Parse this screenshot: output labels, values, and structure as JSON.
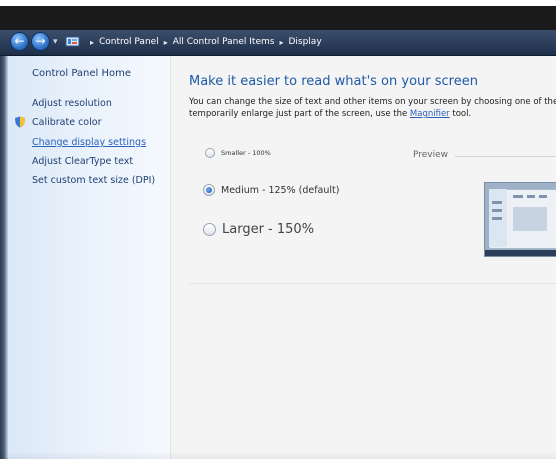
{
  "breadcrumb": {
    "items": [
      "Control Panel",
      "All Control Panel Items",
      "Display"
    ],
    "separator": "▸"
  },
  "nav": {
    "back_icon": "back-arrow-icon",
    "forward_icon": "forward-arrow-icon",
    "dropdown_icon": "dropdown-arrow-icon",
    "location_icon": "control-panel-icon"
  },
  "sidebar": {
    "home": "Control Panel Home",
    "items": [
      {
        "label": "Adjust resolution",
        "icon": ""
      },
      {
        "label": "Calibrate color",
        "icon": "shield-icon"
      },
      {
        "label": "Change display settings",
        "icon": "",
        "active": true
      },
      {
        "label": "Adjust ClearType text",
        "icon": ""
      },
      {
        "label": "Set custom text size (DPI)",
        "icon": ""
      }
    ]
  },
  "main": {
    "title": "Make it easier to read what's on your screen",
    "description_line1": "You can change the size of text and other items on your screen by choosing one of the",
    "description_line2_prefix": "temporarily enlarge just part of the screen, use the",
    "description_link": "Magnifier",
    "description_line2_suffix": "tool.",
    "preview_label": "Preview",
    "options": [
      {
        "label": "Smaller - 100%",
        "selected": false
      },
      {
        "label": "Medium - 125% (default)",
        "selected": true
      },
      {
        "label": "Larger - 150%",
        "selected": false
      }
    ]
  },
  "colors": {
    "title_blue": "#1e5aa7",
    "link_blue": "#2b61b7",
    "sidebar_text": "#1f3f73",
    "nav_bar": "#2a3d5c"
  }
}
